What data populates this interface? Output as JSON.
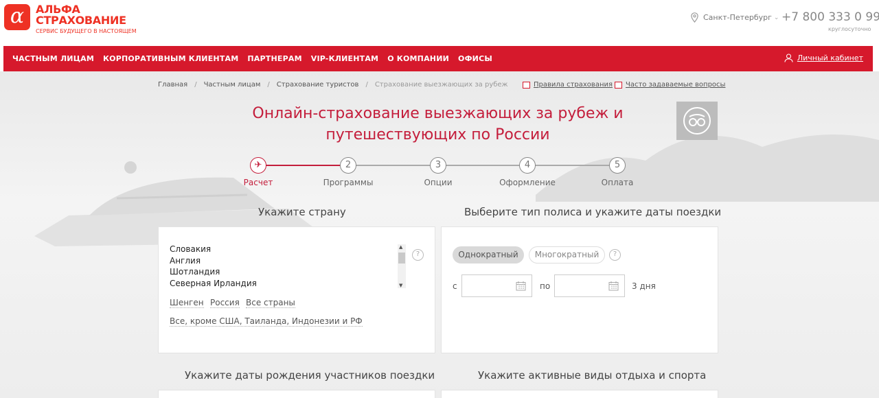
{
  "logo": {
    "mark": "α",
    "line1": "АЛЬФА",
    "line2": "СТРАХОВАНИЕ",
    "tagline": "СЕРВИС БУДУЩЕГО В НАСТОЯЩЕМ"
  },
  "header": {
    "city": "Санкт-Петербург",
    "phone": "+7 800 333 0 999",
    "phone_note": "круглосуточно"
  },
  "nav": {
    "items": [
      "ЧАСТНЫМ ЛИЦАМ",
      "КОРПОРАТИВНЫМ КЛИЕНТАМ",
      "ПАРТНЕРАМ",
      "VIP-КЛИЕНТАМ",
      "О КОМПАНИИ",
      "ОФИСЫ"
    ],
    "cabinet": "Личный кабинет"
  },
  "breadcrumb": {
    "items": [
      "Главная",
      "Частным лицам",
      "Страхование туристов"
    ],
    "current": "Страхование выезжающих за рубеж",
    "separator": "/"
  },
  "links": {
    "rules": "Правила страхования",
    "faq": "Часто задаваемые вопросы"
  },
  "page": {
    "title_line1": "Онлайн-страхование выезжающих за рубеж и",
    "title_line2": "путешествующих по России",
    "badge": "tripadvisor"
  },
  "steps": [
    {
      "num": "✈",
      "label": "Расчет",
      "active": true
    },
    {
      "num": "2",
      "label": "Программы",
      "active": false
    },
    {
      "num": "3",
      "label": "Опции",
      "active": false
    },
    {
      "num": "4",
      "label": "Оформление",
      "active": false
    },
    {
      "num": "5",
      "label": "Оплата",
      "active": false
    }
  ],
  "country": {
    "title": "Укажите страну",
    "list": [
      "Словакия",
      "Англия",
      "Шотландия",
      "Северная Ирландия"
    ],
    "quick": [
      "Шенген",
      "Россия",
      "Все страны"
    ],
    "all_except": "Все, кроме США, Таиланда, Индонезии и РФ",
    "help": "?"
  },
  "policy": {
    "title": "Выберите тип полиса и укажите даты поездки",
    "single": "Однократный",
    "multi": "Многократный",
    "from": "с",
    "to": "по",
    "days": "3 дня",
    "help": "?"
  },
  "birth": {
    "title": "Укажите даты рождения участников поездки"
  },
  "sport": {
    "title": "Укажите активные виды отдыха и спорта"
  },
  "colors": {
    "brand": "#d6192c",
    "title": "#c41d3b"
  }
}
